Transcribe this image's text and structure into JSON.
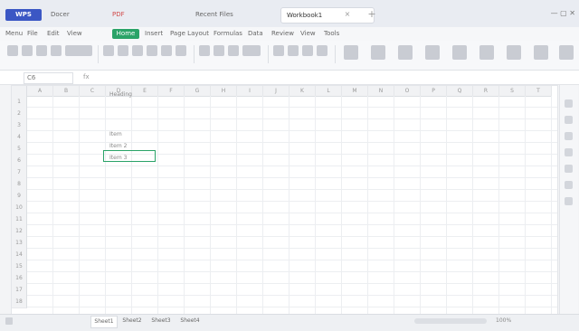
{
  "titlebar": {
    "app_logo": "WPS",
    "tabs": [
      {
        "label": "Docer"
      },
      {
        "label": "PDF"
      },
      {
        "label": "Recent Files"
      },
      {
        "label": "Workbook1"
      }
    ],
    "close_glyph": "×",
    "add_glyph": "+",
    "window_controls": "— ▢ ✕"
  },
  "menubar": {
    "items": [
      "Menu",
      "File",
      "Edit",
      "View",
      "Home",
      "Insert",
      "Page Layout",
      "Formulas",
      "Data",
      "Review",
      "View",
      "Tools"
    ]
  },
  "formulabar": {
    "name_box": "C6",
    "fx_label": "fx",
    "formula_value": ""
  },
  "grid": {
    "columns": [
      "A",
      "B",
      "C",
      "D",
      "E",
      "F",
      "G",
      "H",
      "I",
      "J",
      "K",
      "L",
      "M",
      "N",
      "O",
      "P",
      "Q",
      "R",
      "S",
      "T"
    ],
    "rows": [
      "1",
      "2",
      "3",
      "4",
      "5",
      "6",
      "7",
      "8",
      "9",
      "10",
      "11",
      "12",
      "13",
      "14",
      "15",
      "16",
      "17",
      "18"
    ],
    "cells": [
      {
        "text": "Heading"
      },
      {
        "text": "Item"
      },
      {
        "text": "Item 2"
      },
      {
        "text": "Item 3"
      }
    ]
  },
  "sheetbar": {
    "tabs": [
      "Sheet1",
      "Sheet2",
      "Sheet3",
      "Sheet4"
    ],
    "status": "100%"
  },
  "colors": {
    "accent_green": "#2aa368",
    "logo_blue": "#3b57c4"
  }
}
